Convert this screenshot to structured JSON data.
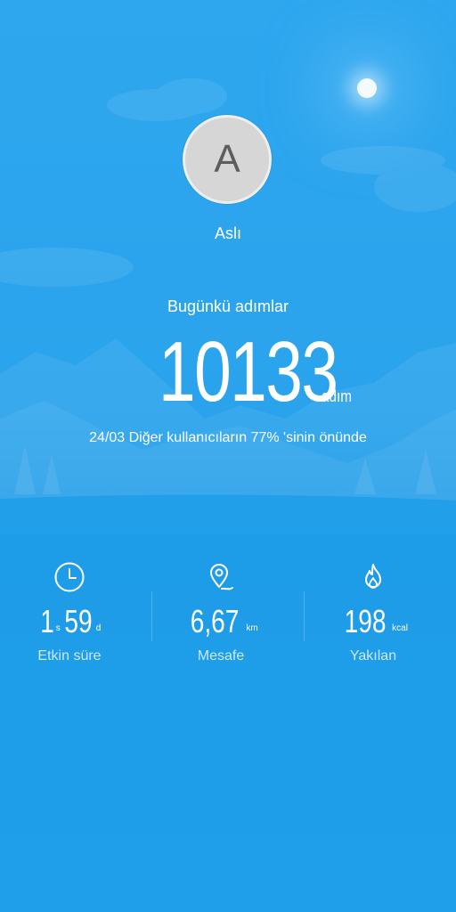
{
  "profile": {
    "avatar_letter": "A",
    "name": "Aslı"
  },
  "steps": {
    "label": "Bugünkü adımlar",
    "value": "10133",
    "unit": "adım",
    "comparison": "24/03 Diğer kullanıcıların 77% 'sinin önünde"
  },
  "stats": {
    "active_time": {
      "hours": "1",
      "hours_unit": "s",
      "minutes": "59",
      "minutes_unit": "d",
      "label": "Etkin süre",
      "icon": "clock-icon"
    },
    "distance": {
      "value": "6,67",
      "unit": "km",
      "label": "Mesafe",
      "icon": "location-pin-icon"
    },
    "calories": {
      "value": "198",
      "unit": "kcal",
      "label": "Yakılan",
      "icon": "flame-icon"
    }
  },
  "colors": {
    "background": "#1e9ee9",
    "avatar_bg": "#d6d6d6",
    "avatar_letter": "#5d5d5d"
  }
}
